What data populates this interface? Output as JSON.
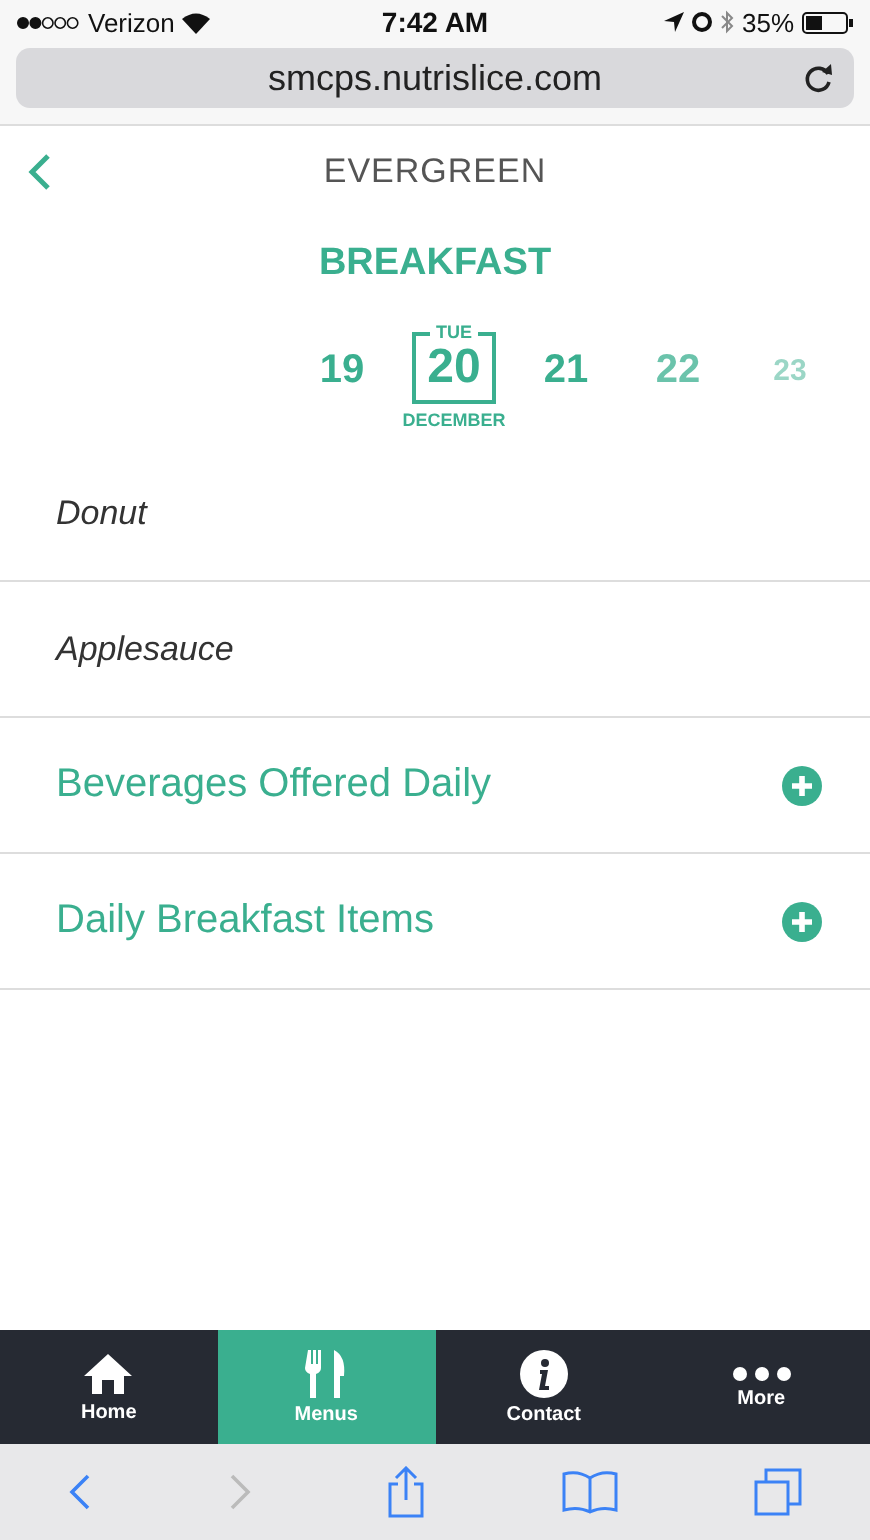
{
  "status_bar": {
    "carrier": "Verizon",
    "time": "7:42 AM",
    "battery": "35%"
  },
  "browser": {
    "url": "smcps.nutrislice.com"
  },
  "header": {
    "title": "EVERGREEN"
  },
  "meal": "BREAKFAST",
  "dates": [
    {
      "day": "19",
      "selected": false
    },
    {
      "day": "20",
      "weekday": "TUE",
      "month": "DECEMBER",
      "selected": true
    },
    {
      "day": "21",
      "selected": false
    },
    {
      "day": "22",
      "selected": false
    },
    {
      "day": "23",
      "selected": false
    }
  ],
  "menu_items": [
    {
      "kind": "food",
      "label": "Donut"
    },
    {
      "kind": "food",
      "label": "Applesauce"
    },
    {
      "kind": "category",
      "label": "Beverages Offered Daily"
    },
    {
      "kind": "category",
      "label": "Daily Breakfast Items"
    }
  ],
  "tabs": [
    {
      "kind": "home",
      "label": "Home",
      "selected": false
    },
    {
      "kind": "menus",
      "label": "Menus",
      "selected": true
    },
    {
      "kind": "info",
      "label": "Contact",
      "selected": false
    },
    {
      "kind": "more",
      "label": "More",
      "selected": false
    }
  ]
}
